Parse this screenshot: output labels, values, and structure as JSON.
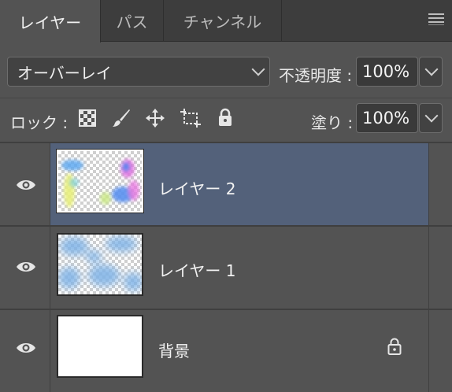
{
  "tabs": [
    {
      "label": "レイヤー",
      "active": true
    },
    {
      "label": "パス",
      "active": false
    },
    {
      "label": "チャンネル",
      "active": false
    }
  ],
  "panel_menu_icon": "hamburger-icon",
  "blend_mode": {
    "value": "オーバーレイ"
  },
  "opacity": {
    "label": "不透明度 :",
    "value": "100%"
  },
  "lock": {
    "label": "ロック :",
    "icons": [
      "lock-transparent-pixels-icon",
      "lock-image-pixels-icon",
      "lock-position-icon",
      "lock-artboard-icon",
      "lock-all-icon"
    ]
  },
  "fill": {
    "label": "塗り :",
    "value": "100%"
  },
  "layers": [
    {
      "name": "レイヤー 2",
      "visible": true,
      "selected": true,
      "locked": false
    },
    {
      "name": "レイヤー 1",
      "visible": true,
      "selected": false,
      "locked": false
    },
    {
      "name": "背景",
      "visible": true,
      "selected": false,
      "locked": true
    }
  ],
  "colors": {
    "panel": "#535353",
    "selected": "#53617a",
    "tabbar": "#3d3d3d"
  }
}
